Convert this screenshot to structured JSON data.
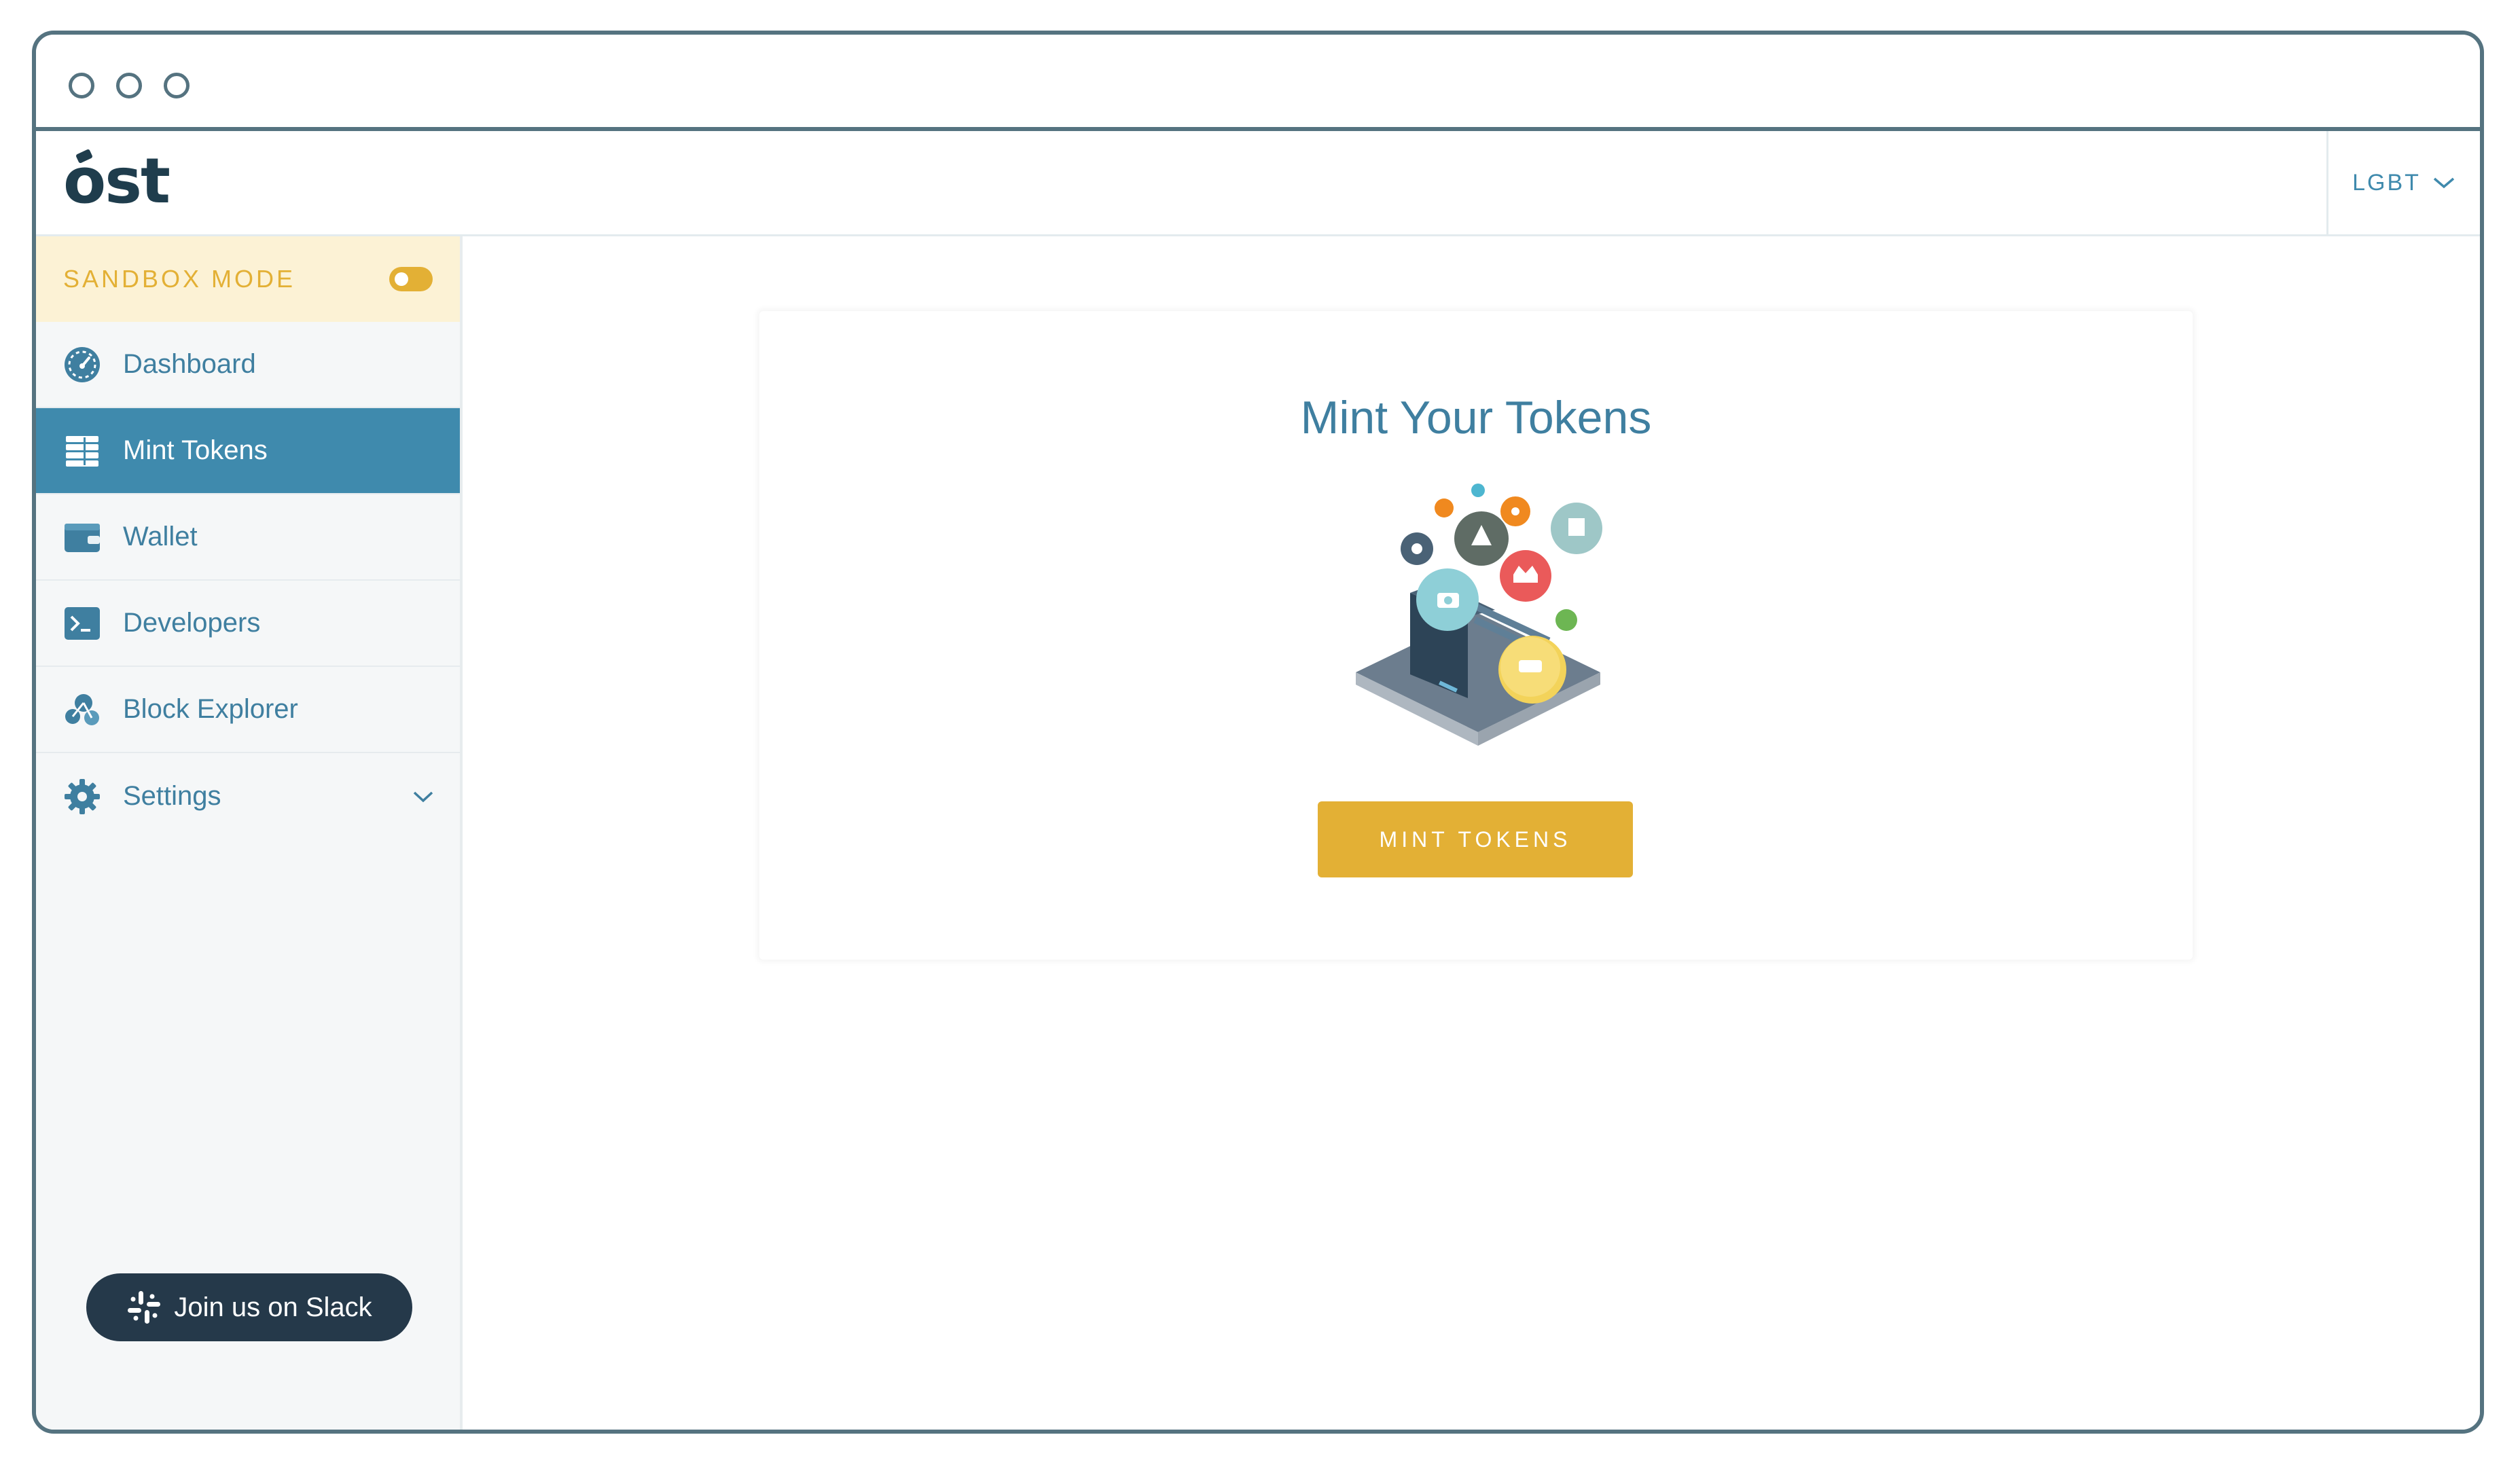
{
  "colors": {
    "window_border": "#557380",
    "primary": "#3f8aad",
    "accent_yellow": "#e3b035",
    "sandbox_bg": "#fcf2d5",
    "sidebar_bg": "#f5f7f8",
    "slack_bg": "#25394a",
    "logo": "#1f3d4d"
  },
  "header": {
    "logo_text": "ost",
    "language_selector": {
      "value": "LGBT",
      "icon": "chevron-down-icon"
    }
  },
  "sidebar": {
    "sandbox_label": "SANDBOX MODE",
    "sandbox_enabled": true,
    "items": [
      {
        "label": "Dashboard",
        "icon": "speedometer-icon",
        "active": false
      },
      {
        "label": "Mint Tokens",
        "icon": "coin-stack-icon",
        "active": true
      },
      {
        "label": "Wallet",
        "icon": "wallet-icon",
        "active": false
      },
      {
        "label": "Developers",
        "icon": "terminal-icon",
        "active": false
      },
      {
        "label": "Block Explorer",
        "icon": "network-icon",
        "active": false
      },
      {
        "label": "Settings",
        "icon": "gear-icon",
        "active": false,
        "expandable": true
      }
    ],
    "slack_button": {
      "label": "Join us on Slack",
      "icon": "slack-icon"
    }
  },
  "main": {
    "card_title": "Mint Your Tokens",
    "illustration": "token-minting-illustration",
    "mint_button_label": "MINT TOKENS"
  }
}
